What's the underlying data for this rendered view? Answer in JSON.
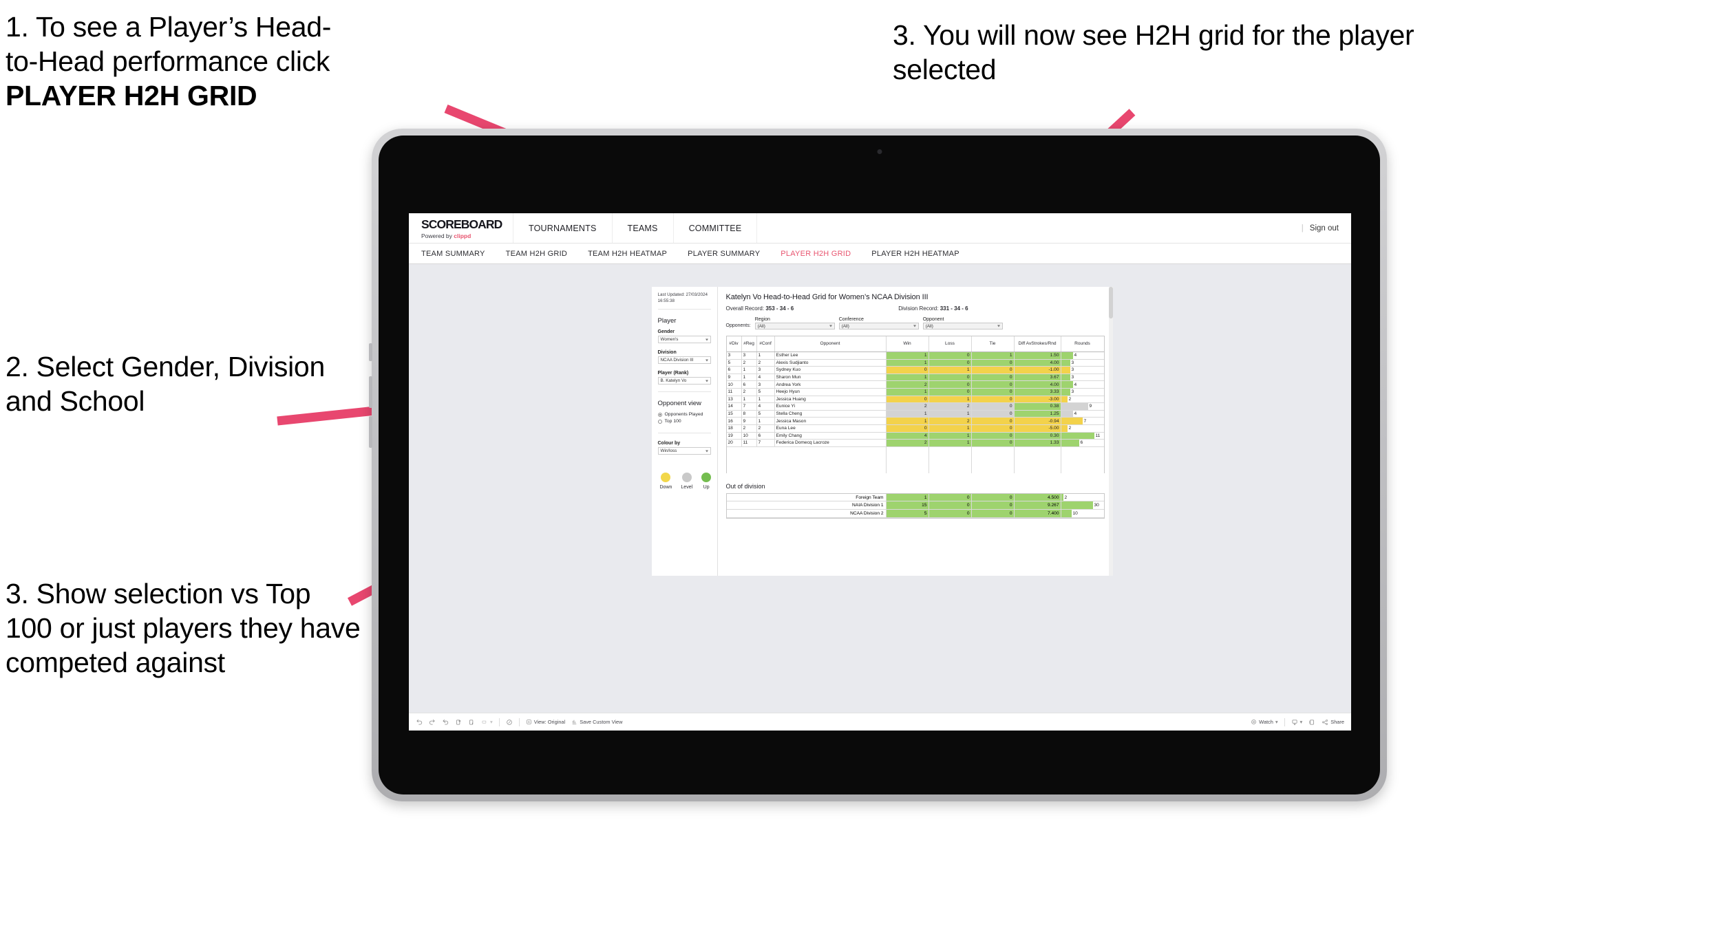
{
  "annotations": [
    {
      "id": "anno-1",
      "line1": "1. To see a Player’s Head-",
      "line2": "to-Head performance click",
      "bold": "PLAYER H2H GRID"
    },
    {
      "id": "anno-2",
      "text": "2. Select Gender, Division and School"
    },
    {
      "id": "anno-3",
      "text": "3. Show selection vs Top 100 or just players they have competed against"
    },
    {
      "id": "anno-4",
      "text": "3. You will now see H2H grid for the player selected"
    }
  ],
  "colors": {
    "accent_pink": "#e8546f",
    "win_green": "#9ed36e",
    "loss_yellow": "#f3d24b",
    "level_grey": "#d3d3d3",
    "legend_down": "#f2d74a",
    "legend_level": "#c9c9c9",
    "legend_up": "#74bd4f"
  },
  "topbar": {
    "brand_title": "SCOREBOARD",
    "brand_sub_prefix": "Powered by ",
    "brand_sub_brand": "clippd",
    "nav": [
      "TOURNAMENTS",
      "TEAMS",
      "COMMITTEE"
    ],
    "separator": "|",
    "signout": "Sign out"
  },
  "subnav": {
    "items": [
      {
        "label": "TEAM SUMMARY",
        "active": false
      },
      {
        "label": "TEAM H2H GRID",
        "active": false
      },
      {
        "label": "TEAM H2H HEATMAP",
        "active": false
      },
      {
        "label": "PLAYER SUMMARY",
        "active": false
      },
      {
        "label": "PLAYER H2H GRID",
        "active": true
      },
      {
        "label": "PLAYER H2H HEATMAP",
        "active": false
      }
    ]
  },
  "panel": {
    "last_updated": "Last Updated: 27/03/2024 16:55:38",
    "heading": "Player",
    "gender_label": "Gender",
    "gender_value": "Women's",
    "division_label": "Division",
    "division_value": "NCAA Division III",
    "player_label": "Player (Rank)",
    "player_value": "B. Katelyn Vo",
    "opponent_view_heading": "Opponent view",
    "opponent_view_options": [
      {
        "label": "Opponents Played",
        "selected": true
      },
      {
        "label": "Top 100",
        "selected": false
      }
    ],
    "colour_by_label": "Colour by",
    "colour_by_value": "Win/loss",
    "legend": [
      {
        "caption": "Down",
        "color": "#f2d74a"
      },
      {
        "caption": "Level",
        "color": "#c9c9c9"
      },
      {
        "caption": "Up",
        "color": "#74bd4f"
      }
    ]
  },
  "viz": {
    "title": "Katelyn Vo Head-to-Head Grid for Women’s NCAA Division III",
    "overall_record_label": "Overall Record:",
    "overall_record_value": "353 - 34 - 6",
    "division_record_label": "Division Record:",
    "division_record_value": "331 - 34 - 6",
    "opponents_label": "Opponents:",
    "filters": [
      {
        "label": "Region",
        "value": "(All)"
      },
      {
        "label": "Conference",
        "value": "(All)"
      },
      {
        "label": "Opponent",
        "value": "(All)"
      }
    ],
    "out_of_division_title": "Out of division"
  },
  "chart_data": {
    "type": "table",
    "title": "Katelyn Vo Head-to-Head Grid for Women’s NCAA Division III",
    "columns": [
      "# Div",
      "# Reg",
      "# Conf",
      "Opponent",
      "Win",
      "Loss",
      "Tie",
      "Diff Av Strokes/Rnd",
      "Rounds"
    ],
    "column_header_lines": [
      [
        "#",
        "Div"
      ],
      [
        "#",
        "Reg"
      ],
      [
        "#",
        "Conf"
      ],
      [
        "Opponent"
      ],
      [
        "Win"
      ],
      [
        "Loss"
      ],
      [
        "Tie"
      ],
      [
        "Diff Av",
        "Strokes/Rnd"
      ],
      [
        "Rounds"
      ]
    ],
    "rounds_max": 11,
    "rows": [
      {
        "div": "3",
        "reg": "3",
        "conf": "1",
        "opponent": "Esther Lee",
        "win": "1",
        "loss": "0",
        "tie": "1",
        "diff": "1.50",
        "rounds": "4",
        "status": "g"
      },
      {
        "div": "5",
        "reg": "2",
        "conf": "2",
        "opponent": "Alexis Sudjianto",
        "win": "1",
        "loss": "0",
        "tie": "0",
        "diff": "4.00",
        "rounds": "3",
        "status": "g"
      },
      {
        "div": "6",
        "reg": "1",
        "conf": "3",
        "opponent": "Sydney Kuo",
        "win": "0",
        "loss": "1",
        "tie": "0",
        "diff": "-1.00",
        "rounds": "3",
        "status": "y"
      },
      {
        "div": "9",
        "reg": "1",
        "conf": "4",
        "opponent": "Sharon Mun",
        "win": "1",
        "loss": "0",
        "tie": "0",
        "diff": "3.67",
        "rounds": "3",
        "status": "g"
      },
      {
        "div": "10",
        "reg": "6",
        "conf": "3",
        "opponent": "Andrea York",
        "win": "2",
        "loss": "0",
        "tie": "0",
        "diff": "4.00",
        "rounds": "4",
        "status": "g"
      },
      {
        "div": "11",
        "reg": "2",
        "conf": "5",
        "opponent": "Heejo Hyun",
        "win": "1",
        "loss": "0",
        "tie": "0",
        "diff": "3.33",
        "rounds": "3",
        "status": "g"
      },
      {
        "div": "13",
        "reg": "1",
        "conf": "1",
        "opponent": "Jessica Huang",
        "win": "0",
        "loss": "1",
        "tie": "0",
        "diff": "-3.00",
        "rounds": "2",
        "status": "y"
      },
      {
        "div": "14",
        "reg": "7",
        "conf": "4",
        "opponent": "Eunice Yi",
        "win": "2",
        "loss": "2",
        "tie": "0",
        "diff": "0.38",
        "rounds": "9",
        "status": "n",
        "diff_status": "g"
      },
      {
        "div": "15",
        "reg": "8",
        "conf": "5",
        "opponent": "Stella Cheng",
        "win": "1",
        "loss": "1",
        "tie": "0",
        "diff": "1.25",
        "rounds": "4",
        "status": "n",
        "diff_status": "g"
      },
      {
        "div": "16",
        "reg": "9",
        "conf": "1",
        "opponent": "Jessica Mason",
        "win": "1",
        "loss": "2",
        "tie": "0",
        "diff": "-0.94",
        "rounds": "7",
        "status": "y"
      },
      {
        "div": "18",
        "reg": "2",
        "conf": "2",
        "opponent": "Euna Lee",
        "win": "0",
        "loss": "1",
        "tie": "0",
        "diff": "-5.00",
        "rounds": "2",
        "status": "y"
      },
      {
        "div": "19",
        "reg": "10",
        "conf": "6",
        "opponent": "Emily Chang",
        "win": "4",
        "loss": "1",
        "tie": "0",
        "diff": "0.30",
        "rounds": "11",
        "status": "g"
      },
      {
        "div": "20",
        "reg": "11",
        "conf": "7",
        "opponent": "Federica Domecq Lacroze",
        "win": "2",
        "loss": "1",
        "tie": "0",
        "diff": "1.33",
        "rounds": "6",
        "status": "g"
      }
    ],
    "out_of_division": {
      "rounds_max": 30,
      "rows": [
        {
          "name": "Foreign Team",
          "win": "1",
          "loss": "0",
          "tie": "0",
          "diff": "4.500",
          "rounds": "2",
          "status": "g"
        },
        {
          "name": "NAIA Division 1",
          "win": "15",
          "loss": "0",
          "tie": "0",
          "diff": "9.267",
          "rounds": "30",
          "status": "g"
        },
        {
          "name": "NCAA Division 2",
          "win": "5",
          "loss": "0",
          "tie": "0",
          "diff": "7.400",
          "rounds": "10",
          "status": "g"
        }
      ]
    }
  },
  "toolbar": {
    "view_original": "View: Original",
    "save_custom_view": "Save Custom View",
    "watch": "Watch",
    "share": "Share"
  }
}
